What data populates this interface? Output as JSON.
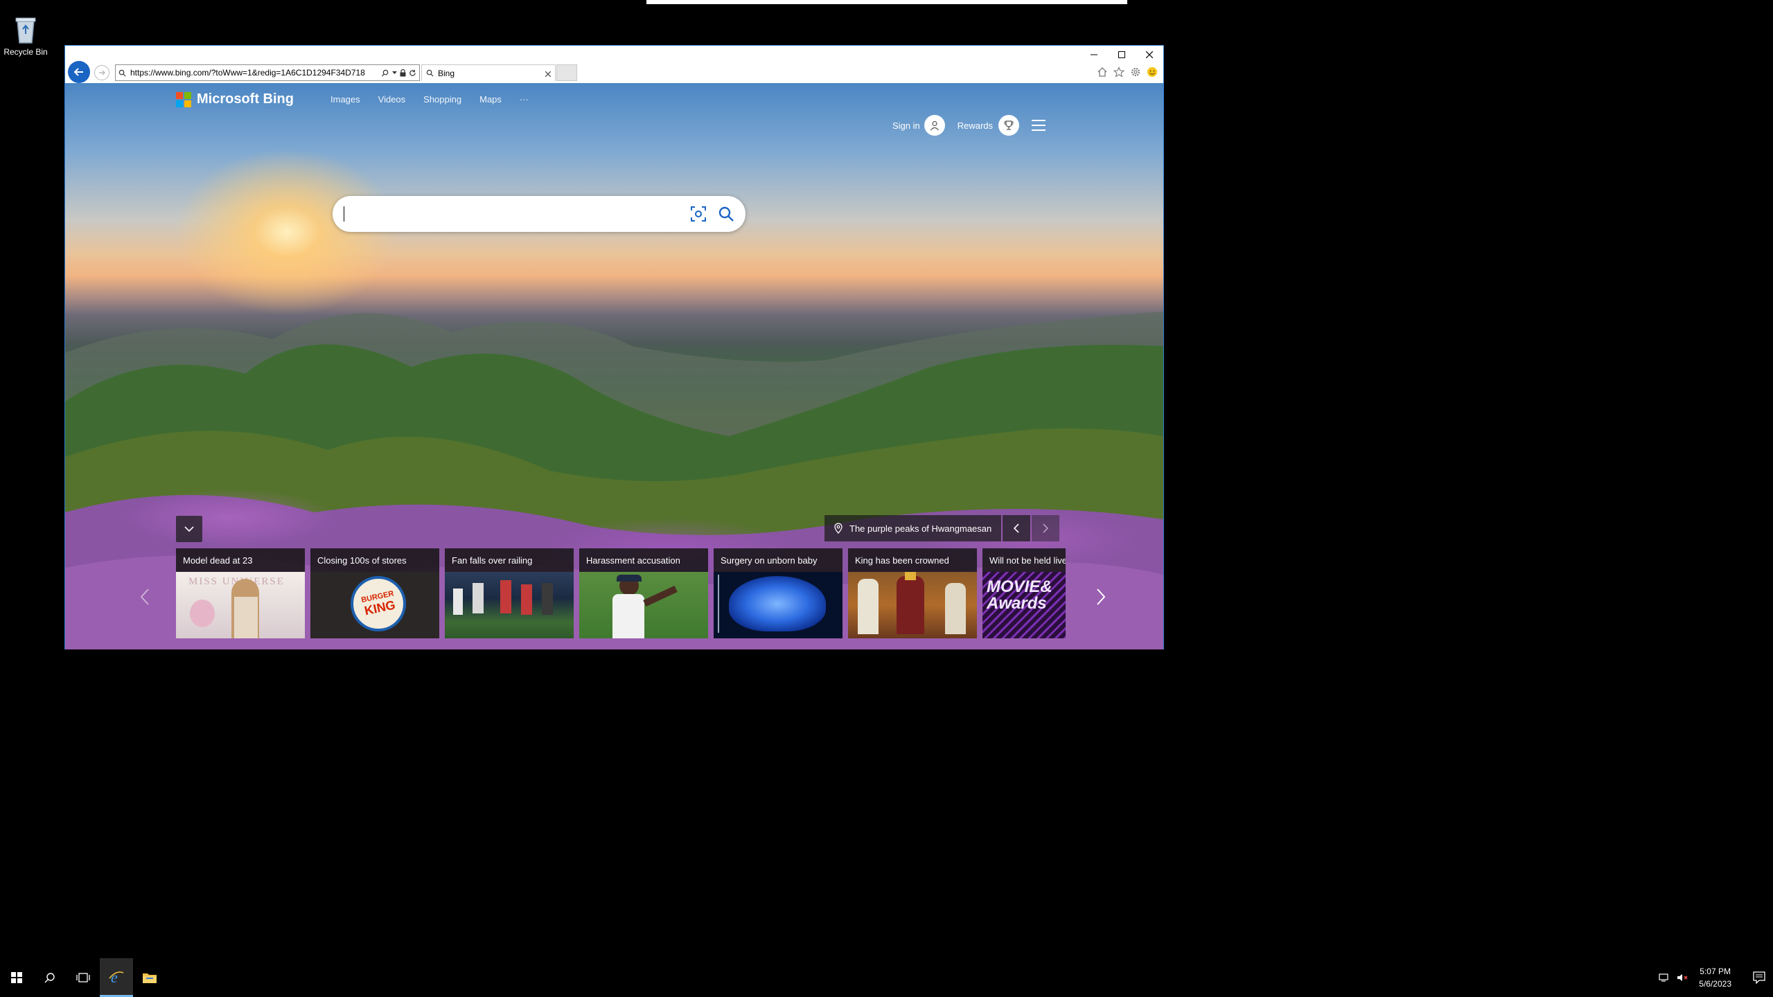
{
  "desktop": {
    "recycle_bin_label": "Recycle Bin"
  },
  "browser": {
    "url": "https://www.bing.com/?toWww=1&redig=1A6C1D1294F34D718",
    "tab_title": "Bing"
  },
  "bing": {
    "logo_text": "Microsoft Bing",
    "nav": [
      "Images",
      "Videos",
      "Shopping",
      "Maps"
    ],
    "nav_more": "···",
    "sign_in": "Sign in",
    "rewards": "Rewards",
    "search_value": "",
    "location_caption": "The purple peaks of Hwangmaesan",
    "news_cards": [
      {
        "title": "Model dead at 23"
      },
      {
        "title": "Closing 100s of stores"
      },
      {
        "title": "Fan falls over railing"
      },
      {
        "title": "Harassment accusation"
      },
      {
        "title": "Surgery on unborn baby"
      },
      {
        "title": "King has been crowned"
      },
      {
        "title": "Will not be held live"
      }
    ],
    "card_texts": {
      "miss_universe": "MISS UNIVERSE",
      "burger_king_1": "BURGER",
      "burger_king_2": "KING",
      "movie_awards": "MOVIE& Awards"
    }
  },
  "taskbar": {
    "time": "5:07 PM",
    "date": "5/6/2023"
  },
  "colors": {
    "accent": "#1a64c3",
    "window_border": "#2b79d0"
  }
}
